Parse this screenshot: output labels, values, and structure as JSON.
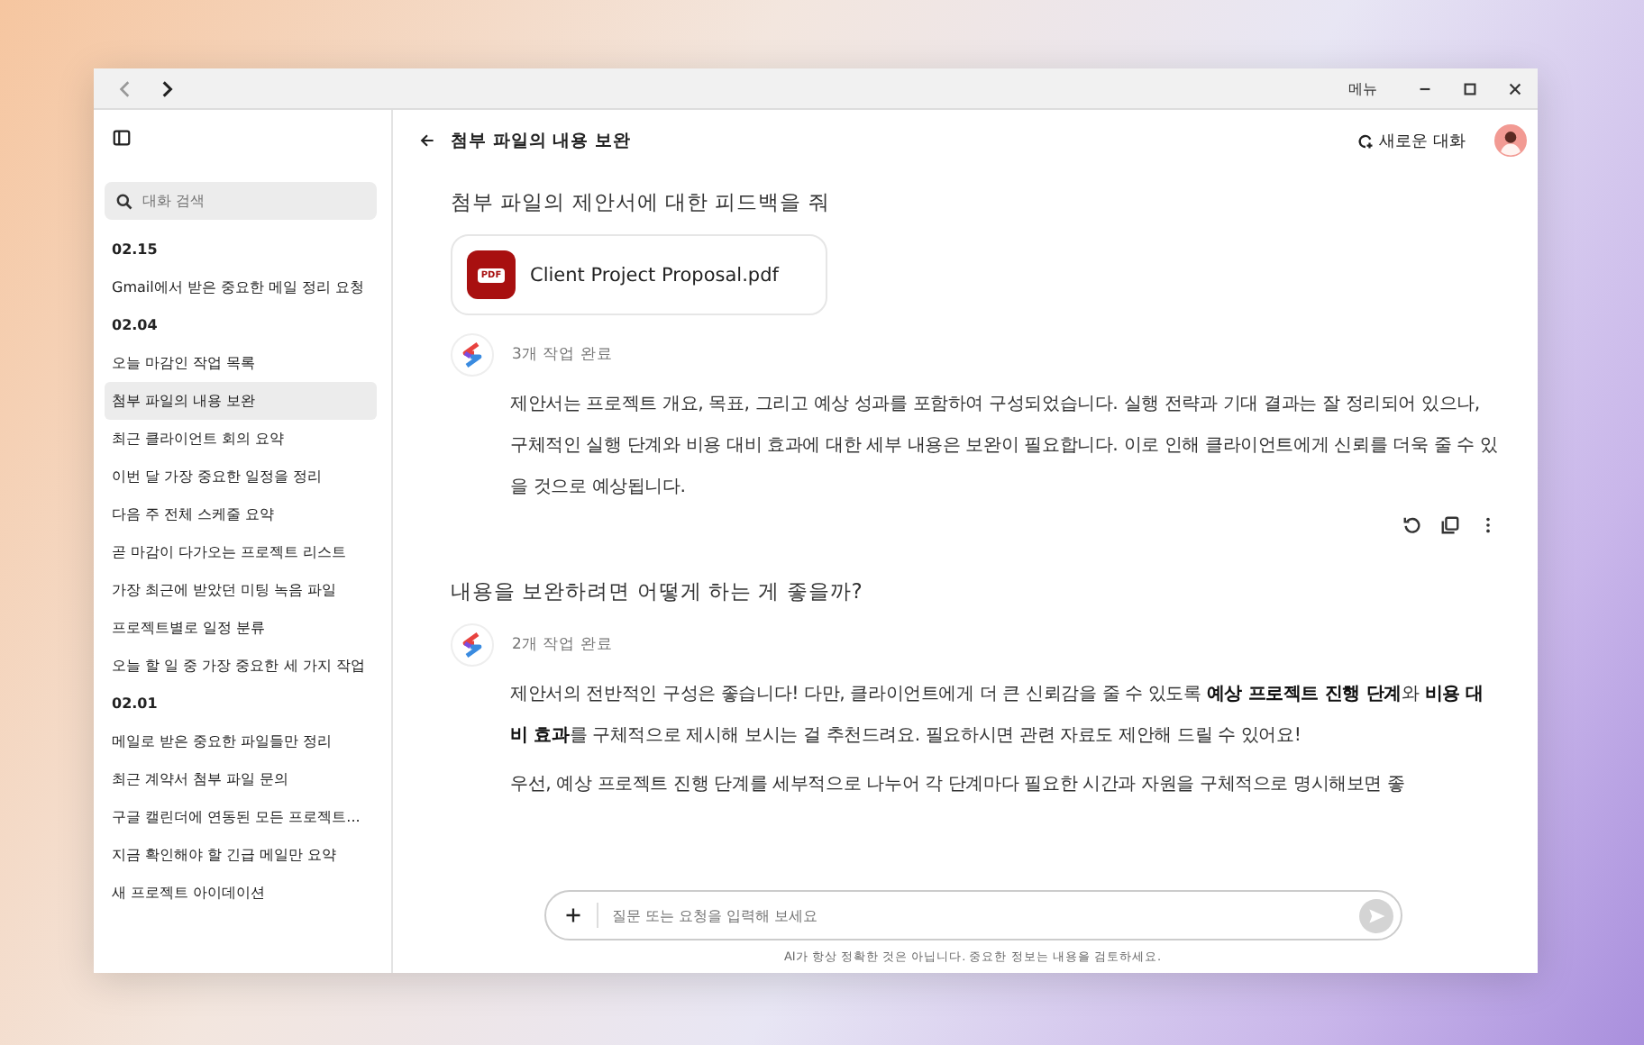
{
  "window": {
    "menu_label": "메뉴"
  },
  "sidebar": {
    "search": {
      "placeholder": "대화 검색"
    },
    "groups": [
      {
        "date": "02.15",
        "items": [
          {
            "label": "Gmail에서 받은 중요한 메일 정리 요청",
            "selected": false
          }
        ]
      },
      {
        "date": "02.04",
        "items": [
          {
            "label": "오늘 마감인 작업 목록",
            "selected": false
          },
          {
            "label": "첨부 파일의 내용 보완",
            "selected": true
          },
          {
            "label": "최근 클라이언트 회의 요약",
            "selected": false
          },
          {
            "label": "이번 달 가장 중요한 일정을 정리",
            "selected": false
          },
          {
            "label": "다음 주 전체 스케줄 요약",
            "selected": false
          },
          {
            "label": "곧 마감이 다가오는 프로젝트 리스트",
            "selected": false
          },
          {
            "label": "가장 최근에 받았던 미팅 녹음 파일",
            "selected": false
          },
          {
            "label": "프로젝트별로 일정 분류",
            "selected": false
          },
          {
            "label": "오늘 할 일 중 가장 중요한 세 가지 작업",
            "selected": false
          }
        ]
      },
      {
        "date": "02.01",
        "items": [
          {
            "label": "메일로 받은 중요한 파일들만 정리",
            "selected": false
          },
          {
            "label": "최근 계약서 첨부 파일 문의",
            "selected": false
          },
          {
            "label": "구글 캘린더에 연동된 모든 프로젝트...",
            "selected": false
          },
          {
            "label": "지금 확인해야 할 긴급 메일만 요약",
            "selected": false
          },
          {
            "label": "새 프로젝트 아이데이션",
            "selected": false
          }
        ]
      }
    ]
  },
  "header": {
    "title": "첨부 파일의 내용 보완",
    "new_chat": "새로운 대화"
  },
  "messages": [
    {
      "kind": "user",
      "text": "첨부 파일의 제안서에 대한 피드백을 줘"
    },
    {
      "kind": "file",
      "badge": "PDF",
      "name": "Client Project Proposal.pdf"
    },
    {
      "kind": "assistant",
      "status": "3개 작업 완료",
      "actions": true,
      "paragraphs": [
        "제안서는 프로젝트 개요, 목표, 그리고 예상 성과를 포함하여 구성되었습니다. 실행 전략과 기대 결과는 잘 정리되어 있으나, 구체적인 실행 단계와 비용 대비 효과에 대한 세부 내용은 보완이 필요합니다. 이로 인해 클라이언트에게 신뢰를 더욱 줄 수 있을 것으로 예상됩니다."
      ]
    },
    {
      "kind": "user",
      "text": "내용을 보완하려면 어떻게 하는 게 좋을까?"
    },
    {
      "kind": "assistant",
      "status": "2개 작업 완료",
      "actions": false,
      "paragraphs": [
        "제안서의 전반적인 구성은 좋습니다! 다만, 클라이언트에게 더 큰 신뢰감을 줄 수 있도록 **예상 프로젝트 진행 단계**와 **비용 대비 효과**를 구체적으로 제시해 보시는 걸 추천드려요. 필요하시면 관련 자료도 제안해 드릴 수 있어요!",
        "우선, 예상 프로젝트 진행 단계를 세부적으로 나누어 각 단계마다 필요한 시간과 자원을 구체적으로 명시해보면 좋"
      ]
    }
  ],
  "composer": {
    "placeholder": "질문 또는 요청을 입력해 보세요",
    "disclaimer": "AI가 항상 정확한 것은 아닙니다. 중요한 정보는 내용을 검토하세요."
  }
}
